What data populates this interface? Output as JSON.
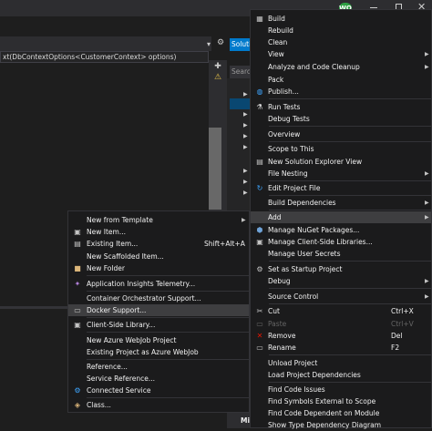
{
  "editor": {
    "code_snippet": "xt(DbContextOptions<CustomerContext> options)"
  },
  "titlebar": {
    "avatar_initials": "WO"
  },
  "solution_explorer": {
    "tab_label": "Solution Explorer",
    "search_placeholder": "Search Solution Explorer"
  },
  "bottom_panel": {
    "label": "Min"
  },
  "context_menu": {
    "items": [
      {
        "label": "Build",
        "icon": "build-icon"
      },
      {
        "label": "Rebuild"
      },
      {
        "label": "Clean"
      },
      {
        "label": "View",
        "submenu": true
      },
      {
        "label": "Analyze and Code Cleanup",
        "submenu": true
      },
      {
        "label": "Pack"
      },
      {
        "label": "Publish...",
        "icon": "publish-globe-icon"
      },
      {
        "label": "Run Tests",
        "icon": "run-tests-icon"
      },
      {
        "label": "Debug Tests"
      },
      {
        "label": "Overview"
      },
      {
        "label": "Scope to This"
      },
      {
        "label": "New Solution Explorer View",
        "icon": "new-view-icon"
      },
      {
        "label": "File Nesting",
        "submenu": true
      },
      {
        "label": "Edit Project File",
        "icon": "edit-project-icon"
      },
      {
        "label": "Build Dependencies",
        "submenu": true
      },
      {
        "label": "Add",
        "submenu": true,
        "highlighted": true
      },
      {
        "label": "Manage NuGet Packages...",
        "icon": "nuget-icon"
      },
      {
        "label": "Manage Client-Side Libraries...",
        "icon": "client-libraries-icon"
      },
      {
        "label": "Manage User Secrets"
      },
      {
        "label": "Set as Startup Project",
        "icon": "startup-gear-icon"
      },
      {
        "label": "Debug",
        "submenu": true
      },
      {
        "label": "Source Control",
        "submenu": true
      },
      {
        "label": "Cut",
        "icon": "scissors-icon",
        "shortcut": "Ctrl+X"
      },
      {
        "label": "Paste",
        "icon": "paste-icon",
        "shortcut": "Ctrl+V",
        "disabled": true
      },
      {
        "label": "Remove",
        "icon": "remove-x-icon",
        "shortcut": "Del"
      },
      {
        "label": "Rename",
        "icon": "rename-icon",
        "shortcut": "F2"
      },
      {
        "label": "Unload Project"
      },
      {
        "label": "Load Project Dependencies"
      },
      {
        "label": "Find Code Issues"
      },
      {
        "label": "Find Symbols External to Scope"
      },
      {
        "label": "Find Code Dependent on Module"
      },
      {
        "label": "Show Type Dependency Diagram"
      }
    ]
  },
  "add_submenu": {
    "items": [
      {
        "label": "New from Template",
        "submenu": true
      },
      {
        "label": "New Item...",
        "icon": "new-item-icon"
      },
      {
        "label": "Existing Item...",
        "icon": "existing-item-icon",
        "shortcut": "Shift+Alt+A"
      },
      {
        "label": "New Scaffolded Item..."
      },
      {
        "label": "New Folder",
        "icon": "folder-icon"
      },
      {
        "label": "Application Insights Telemetry...",
        "icon": "insights-icon"
      },
      {
        "label": "Container Orchestrator Support..."
      },
      {
        "label": "Docker Support...",
        "icon": "docker-icon",
        "highlighted": true
      },
      {
        "label": "Client-Side Library...",
        "icon": "client-library-icon"
      },
      {
        "label": "New Azure WebJob Project"
      },
      {
        "label": "Existing Project as Azure WebJob"
      },
      {
        "label": "Reference..."
      },
      {
        "label": "Service Reference..."
      },
      {
        "label": "Connected Service",
        "icon": "connected-service-icon"
      },
      {
        "label": "Class...",
        "icon": "class-icon"
      }
    ]
  }
}
